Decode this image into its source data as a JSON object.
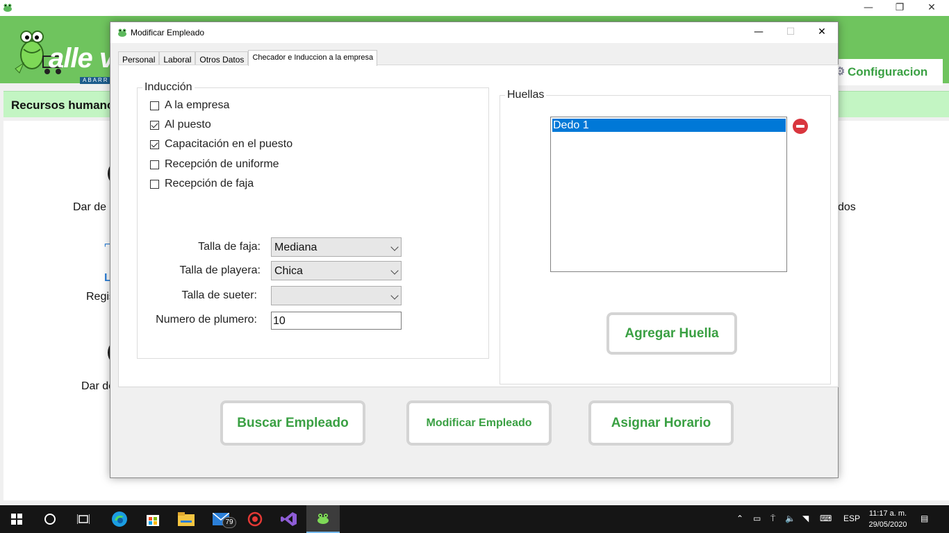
{
  "background": {
    "brand_text": "alle v",
    "brand_sub": "ABARR",
    "config_label": "Configuracion",
    "section_title": "Recursos humanos",
    "label_dar_alta": "Dar de a",
    "label_registro": "Regis",
    "label_dar_baja": "Dar de",
    "label_right": "dos",
    "window_controls": {
      "minimize": "—",
      "restore": "❐",
      "close": "✕"
    }
  },
  "dialog": {
    "title": "Modificar Empleado",
    "controls": {
      "minimize": "—",
      "maximize": "☐",
      "close": "✕"
    },
    "tabs": [
      {
        "label": "Personal"
      },
      {
        "label": "Laboral"
      },
      {
        "label": "Otros Datos"
      },
      {
        "label": "Checador e Induccion a la empresa",
        "active": true
      }
    ],
    "induccion": {
      "title": "Inducción",
      "items": [
        {
          "label": "A la empresa",
          "checked": false
        },
        {
          "label": "Al puesto",
          "checked": true
        },
        {
          "label": "Capacitación en el puesto",
          "checked": true
        },
        {
          "label": "Recepción de uniforme",
          "checked": false
        },
        {
          "label": "Recepción de faja",
          "checked": false
        }
      ],
      "talla_faja_label": "Talla de faja:",
      "talla_faja_value": "Mediana",
      "talla_playera_label": "Talla de playera:",
      "talla_playera_value": "Chica",
      "talla_sueter_label": "Talla de sueter:",
      "talla_sueter_value": "",
      "plumero_label": "Numero de plumero:",
      "plumero_value": "10"
    },
    "huellas": {
      "title": "Huellas",
      "items": [
        "Dedo 1"
      ],
      "add_button": "Agregar Huella"
    },
    "footer": {
      "buscar": "Buscar Empleado",
      "modificar": "Modificar Empleado",
      "asignar": "Asignar Horario"
    }
  },
  "taskbar": {
    "mail_badge": "79",
    "language": "ESP",
    "time": "11:17 a. m.",
    "date": "29/05/2020"
  },
  "colors": {
    "brand_green": "#6fc45e",
    "button_green_text": "#3aa043",
    "selection_blue": "#0078d7",
    "remove_red": "#d9363e"
  }
}
